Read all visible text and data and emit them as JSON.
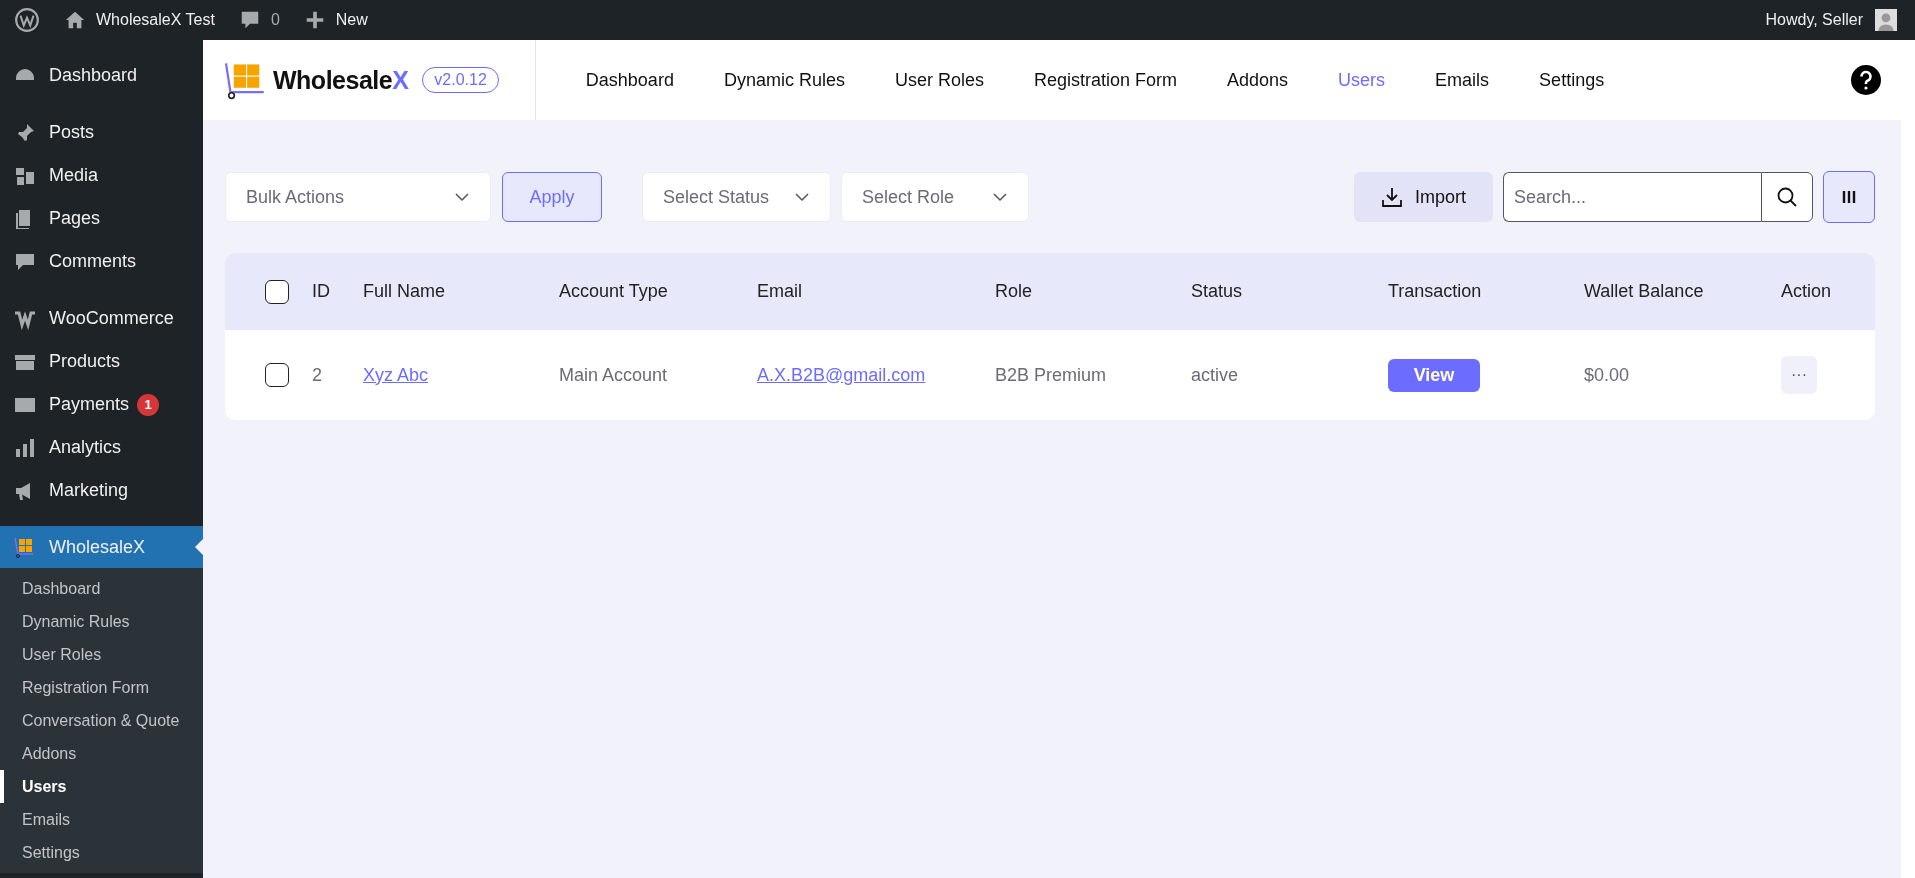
{
  "admin_bar": {
    "site_title": "WholesaleX Test",
    "comments_count": "0",
    "new_label": "New",
    "greeting": "Howdy, Seller"
  },
  "sidebar": {
    "groups": [
      [
        {
          "label": "Dashboard",
          "selected": false
        }
      ],
      [
        {
          "label": "Posts",
          "selected": false
        },
        {
          "label": "Media",
          "selected": false
        },
        {
          "label": "Pages",
          "selected": false
        },
        {
          "label": "Comments",
          "selected": false
        }
      ],
      [
        {
          "label": "WooCommerce",
          "selected": false
        },
        {
          "label": "Products",
          "selected": false
        },
        {
          "label": "Payments",
          "selected": false,
          "badge": "1"
        },
        {
          "label": "Analytics",
          "selected": false
        },
        {
          "label": "Marketing",
          "selected": false
        }
      ],
      [
        {
          "label": "WholesaleX",
          "selected": true,
          "children": [
            {
              "label": "Dashboard",
              "selected": false
            },
            {
              "label": "Dynamic Rules",
              "selected": false
            },
            {
              "label": "User Roles",
              "selected": false
            },
            {
              "label": "Registration Form",
              "selected": false
            },
            {
              "label": "Conversation & Quote",
              "selected": false
            },
            {
              "label": "Addons",
              "selected": false
            },
            {
              "label": "Users",
              "selected": true
            },
            {
              "label": "Emails",
              "selected": false
            },
            {
              "label": "Settings",
              "selected": false
            }
          ]
        }
      ]
    ]
  },
  "header": {
    "brand": "Wholesale",
    "brand_accent": "X",
    "version": "v2.0.12",
    "tabs": [
      {
        "label": "Dashboard",
        "selected": false
      },
      {
        "label": "Dynamic Rules",
        "selected": false
      },
      {
        "label": "User Roles",
        "selected": false
      },
      {
        "label": "Registration Form",
        "selected": false
      },
      {
        "label": "Addons",
        "selected": false
      },
      {
        "label": "Users",
        "selected": true
      },
      {
        "label": "Emails",
        "selected": false
      },
      {
        "label": "Settings",
        "selected": false
      }
    ]
  },
  "toolbar": {
    "bulk_actions": {
      "placeholder": "Bulk Actions"
    },
    "apply": "Apply",
    "status_filter": {
      "placeholder": "Select Status"
    },
    "role_filter": {
      "placeholder": "Select Role"
    },
    "import": "Import",
    "search": {
      "placeholder": "Search..."
    }
  },
  "table": {
    "select_all_checked": false,
    "columns": [
      "ID",
      "Full Name",
      "Account Type",
      "Email",
      "Role",
      "Status",
      "Transaction",
      "Wallet Balance",
      "Action"
    ],
    "rows": [
      {
        "checked": false,
        "id": "2",
        "full_name": "Xyz Abc",
        "account_type": "Main Account",
        "email": "A.X.B2B@gmail.com",
        "role": "B2B Premium",
        "status": "active",
        "transaction": "View",
        "wallet_balance": "$0.00",
        "action": "···"
      }
    ]
  }
}
